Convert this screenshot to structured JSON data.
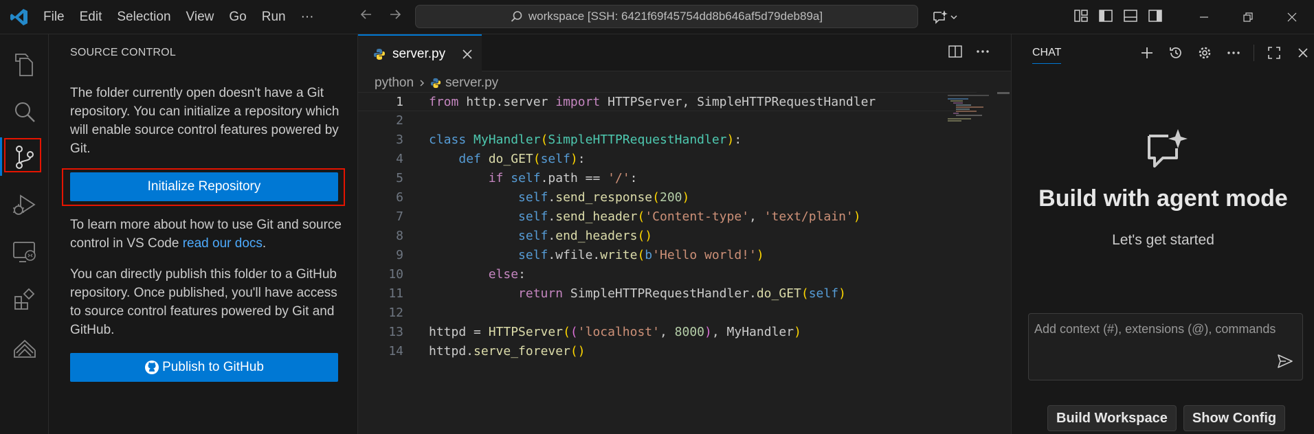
{
  "titlebar": {
    "menu": [
      "File",
      "Edit",
      "Selection",
      "View",
      "Go",
      "Run",
      "···"
    ],
    "search_text": "workspace [SSH: 6421f69f45754dd8b646af5d79deb89a]"
  },
  "sidebar": {
    "title": "SOURCE CONTROL",
    "intro": "The folder currently open doesn't have a Git repository. You can initialize a repository which will enable source control features powered by Git.",
    "init_button": "Initialize Repository",
    "learn_prefix": "To learn more about how to use Git and source control in VS Code ",
    "learn_link": "read our docs",
    "learn_suffix": ".",
    "publish_text": "You can directly publish this folder to a GitHub repository. Once published, you'll have access to source control features powered by Git and GitHub.",
    "publish_button": "Publish to GitHub"
  },
  "editor": {
    "tab_label": "server.py",
    "breadcrumb": [
      "python",
      "server.py"
    ],
    "line_numbers": [
      "1",
      "2",
      "3",
      "4",
      "5",
      "6",
      "7",
      "8",
      "9",
      "10",
      "11",
      "12",
      "13",
      "14"
    ]
  },
  "chat": {
    "title": "CHAT",
    "hero_title": "Build with agent mode",
    "hero_subtitle": "Let's get started",
    "input_placeholder": "Add context (#), extensions (@), commands",
    "buttons": [
      "Build Workspace",
      "Show Config"
    ]
  },
  "colors": {
    "accent": "#0078d4",
    "highlight_box": "#e51400",
    "background": "#1f1f1f"
  }
}
